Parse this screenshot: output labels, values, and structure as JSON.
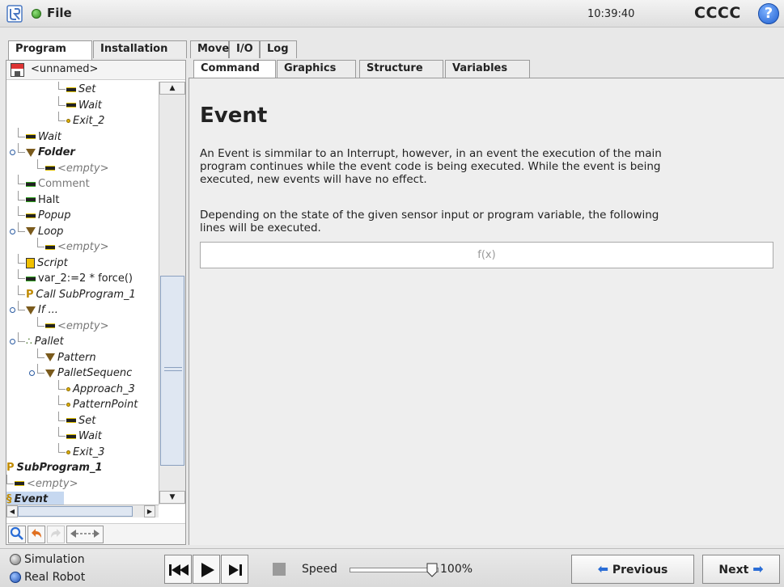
{
  "header": {
    "file_label": "File",
    "clock": "10:39:40",
    "robot_name": "CCCC",
    "help_label": "?"
  },
  "main_tabs": {
    "program": "Program",
    "installation": "Installation",
    "move": "Move",
    "io": "I/O",
    "log": "Log"
  },
  "program": {
    "name": "<unnamed>"
  },
  "tree": [
    {
      "label": "Set",
      "icon": "set-icon",
      "style": "italic"
    },
    {
      "label": "Wait",
      "icon": "wait-icon",
      "style": "italic"
    },
    {
      "label": "Exit_2",
      "icon": "waypoint-icon",
      "style": "italic"
    },
    {
      "label": "Wait",
      "icon": "wait-icon",
      "style": "italic"
    },
    {
      "label": "Folder",
      "icon": "folder-icon",
      "style": "bold-italic"
    },
    {
      "label": "<empty>",
      "icon": "empty-icon",
      "style": "italic-grey"
    },
    {
      "label": "Comment",
      "icon": "comment-icon",
      "style": "grey"
    },
    {
      "label": "Halt",
      "icon": "halt-icon",
      "style": "normal"
    },
    {
      "label": "Popup",
      "icon": "popup-icon",
      "style": "italic"
    },
    {
      "label": "Loop",
      "icon": "loop-icon",
      "style": "italic"
    },
    {
      "label": "<empty>",
      "icon": "empty-icon",
      "style": "italic-grey"
    },
    {
      "label": "Script",
      "icon": "script-icon",
      "style": "italic"
    },
    {
      "label": "var_2:=2 * force()",
      "icon": "assignment-icon",
      "style": "normal"
    },
    {
      "label": "Call SubProgram_1",
      "icon": "call-icon",
      "style": "italic"
    },
    {
      "label": "If ...",
      "icon": "if-icon",
      "style": "italic"
    },
    {
      "label": "<empty>",
      "icon": "empty-icon",
      "style": "italic-grey"
    },
    {
      "label": "Pallet",
      "icon": "pallet-icon",
      "style": "italic"
    },
    {
      "label": "Pattern",
      "icon": "pattern-icon",
      "style": "italic"
    },
    {
      "label": "PalletSequenc",
      "icon": "sequence-icon",
      "style": "italic"
    },
    {
      "label": "Approach_3",
      "icon": "waypoint-icon",
      "style": "italic"
    },
    {
      "label": "PatternPoint",
      "icon": "waypoint-icon",
      "style": "italic"
    },
    {
      "label": "Set",
      "icon": "set-icon",
      "style": "italic"
    },
    {
      "label": "Wait",
      "icon": "wait-icon",
      "style": "italic"
    },
    {
      "label": "Exit_3",
      "icon": "waypoint-icon",
      "style": "italic"
    },
    {
      "label": "SubProgram_1",
      "icon": "subprogram-icon",
      "style": "bold-italic"
    },
    {
      "label": "<empty>",
      "icon": "empty-icon",
      "style": "italic-grey"
    },
    {
      "label": "Event",
      "icon": "event-icon",
      "style": "bold-italic-selected"
    }
  ],
  "content_tabs": {
    "command": "Command",
    "graphics": "Graphics",
    "structure": "Structure",
    "variables": "Variables"
  },
  "content": {
    "title": "Event",
    "para1_line1": "An Event is simmilar to an Interrupt, however, in an event the execution of the main",
    "para1_line2": "program continues while the event code is being executed. While the event is being",
    "para1_line3": "executed, new events will have no effect.",
    "para2_line1": "Depending on the state of the given sensor input or program variable, the following",
    "para2_line2": "lines will be executed.",
    "expression_placeholder": "f(x)"
  },
  "footer": {
    "simulation_label": "Simulation",
    "real_robot_label": "Real Robot",
    "speed_label": "Speed",
    "speed_value": "100%",
    "speed_fraction": 1.0,
    "previous_label": "Previous",
    "next_label": "Next"
  },
  "colors": {
    "accent_blue": "#2a6dd6",
    "status_green": "#2f8a1c",
    "selection": "#c6d8f0"
  }
}
